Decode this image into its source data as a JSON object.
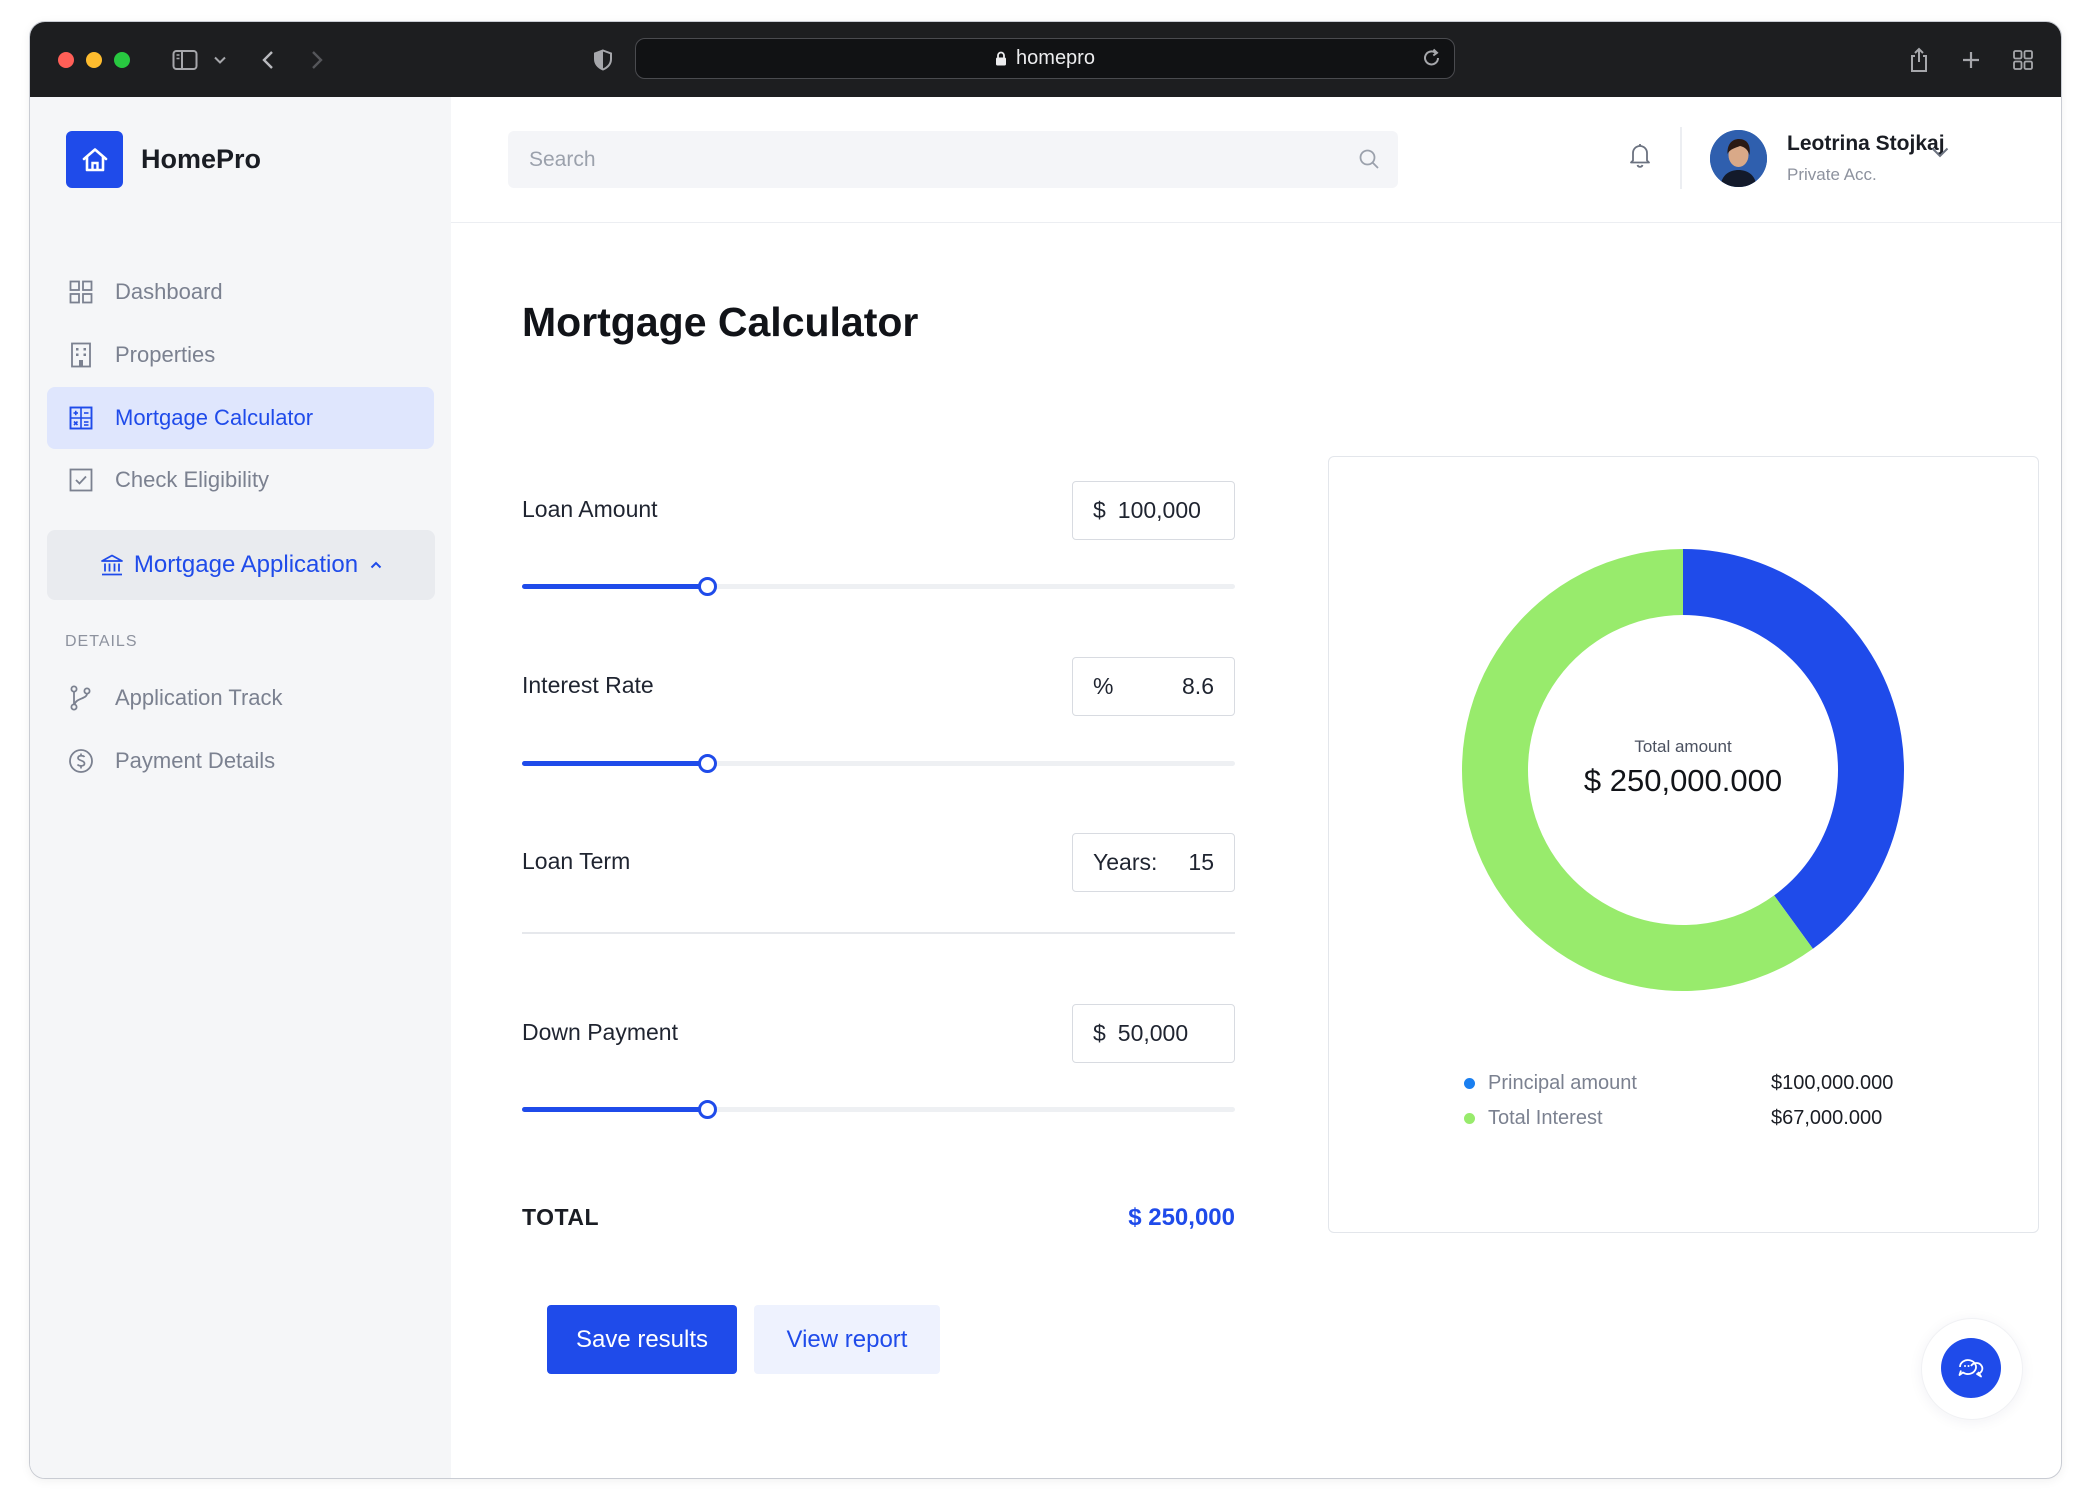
{
  "browser": {
    "url": "homepro"
  },
  "brand": {
    "name": "HomePro"
  },
  "sidebar": {
    "items": [
      {
        "label": "Dashboard",
        "icon": "grid-icon"
      },
      {
        "label": "Properties",
        "icon": "building-icon"
      },
      {
        "label": "Mortgage Calculator",
        "icon": "calculator-icon",
        "active": true
      },
      {
        "label": "Check Eligibility",
        "icon": "checkbox-icon"
      }
    ],
    "group": {
      "label": "Mortgage Application",
      "icon": "bank-icon"
    },
    "section_label": "DETAILS",
    "details": [
      {
        "label": "Application Track",
        "icon": "git-branch-icon"
      },
      {
        "label": "Payment Details",
        "icon": "dollar-circle-icon"
      }
    ]
  },
  "header": {
    "search_placeholder": "Search",
    "user": {
      "name": "Leotrina Stojkaj",
      "account": "Private Acc."
    }
  },
  "main": {
    "title": "Mortgage Calculator",
    "fields": {
      "loan_amount": {
        "label": "Loan Amount",
        "unit": "$",
        "value": "100,000",
        "slider_fraction": 0.26
      },
      "interest_rate": {
        "label": "Interest Rate",
        "unit": "%",
        "value": "8.6",
        "slider_fraction": 0.26
      },
      "loan_term": {
        "label": "Loan Term",
        "unit": "Years:",
        "value": "15"
      },
      "down_payment": {
        "label": "Down Payment",
        "unit": "$",
        "value": "50,000",
        "slider_fraction": 0.26
      }
    },
    "total": {
      "label": "TOTAL",
      "value": "$ 250,000"
    },
    "buttons": {
      "save": "Save results",
      "report": "View report"
    }
  },
  "chart_data": {
    "type": "pie",
    "center_label": "Total amount",
    "center_value": "$ 250,000.000",
    "series": [
      {
        "name": "Principal amount",
        "value": 100000000,
        "display": "$100,000.000",
        "color": "#1f4bea"
      },
      {
        "name": "Total Interest",
        "value": 150000000,
        "display": "$67,000.000",
        "color": "#98eb6c"
      }
    ]
  },
  "colors": {
    "accent": "#1f4bea",
    "interest": "#98eb6c",
    "principal_dot": "#1a7ff0"
  }
}
